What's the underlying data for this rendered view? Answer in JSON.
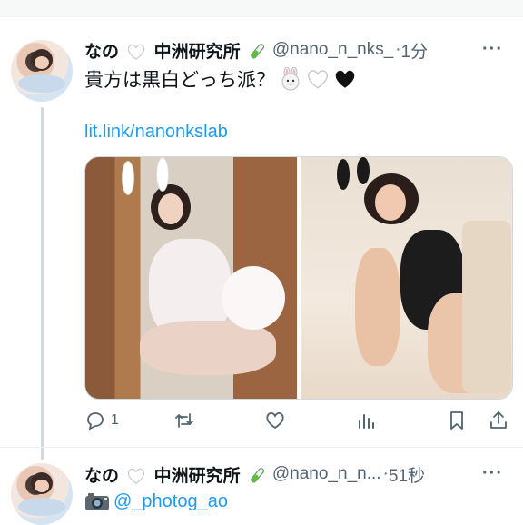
{
  "tweet1": {
    "display_name_part1": "なの",
    "display_name_part2": "中洲研究所",
    "handle": "@nano_n_nks_",
    "separator": "·",
    "time": "1分",
    "more": "···",
    "text": "貴方は黒白どっち派？",
    "link": "lit.link/nanonkslab",
    "actions": {
      "reply_count": "1"
    }
  },
  "tweet2": {
    "display_name_part1": "なの",
    "display_name_part2": "中洲研究所",
    "handle": "@nano_n_n...",
    "separator": "·",
    "time": "51秒",
    "more": "···",
    "mention": "@_photog_ao"
  },
  "colors": {
    "link": "#1d9bf0",
    "secondary_text": "#536471",
    "thread_line": "#cfd9de"
  },
  "icons": [
    "white-heart-icon",
    "test-tube-icon",
    "rabbit-icon",
    "black-heart-icon",
    "reply-icon",
    "retweet-icon",
    "like-icon",
    "views-icon",
    "bookmark-icon",
    "share-icon",
    "camera-icon",
    "more-icon"
  ]
}
